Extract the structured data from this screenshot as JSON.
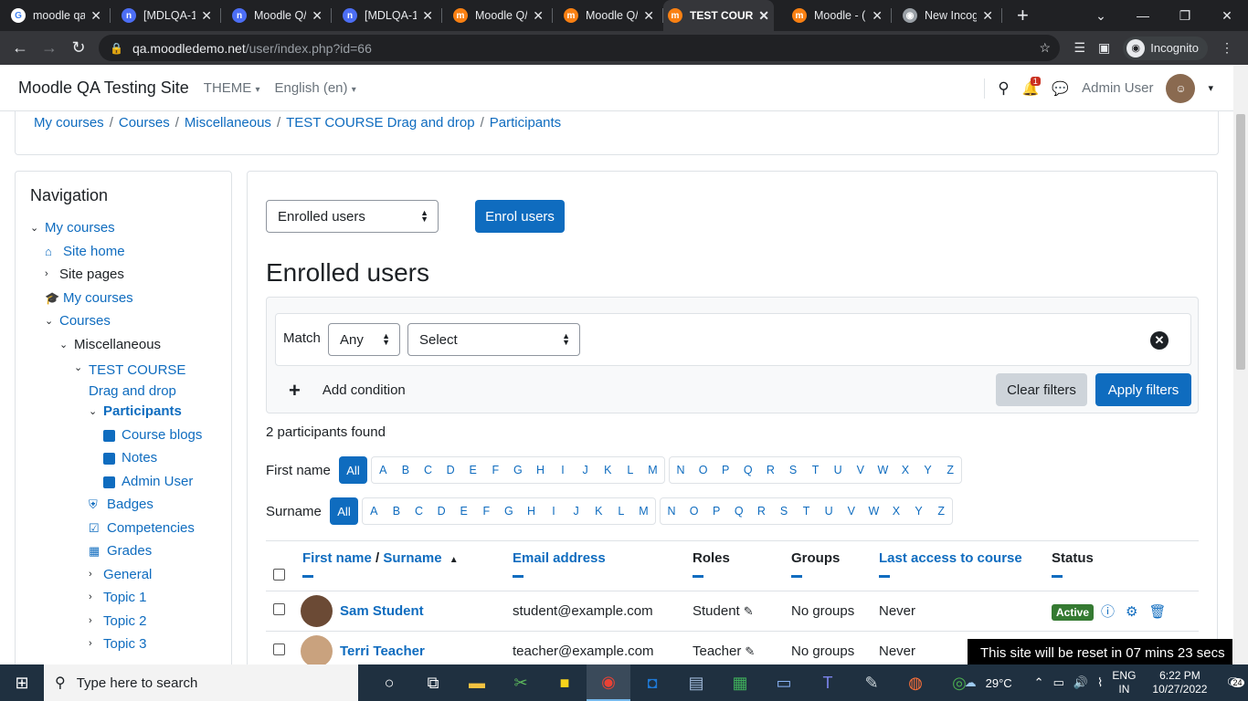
{
  "browser": {
    "tabs": [
      {
        "title": "moodle qa",
        "icon": "google-icon",
        "color": "#ffffff"
      },
      {
        "title": "[MDLQA-1",
        "icon": "jira-icon",
        "color": "#4c6ef5"
      },
      {
        "title": "Moodle Q/",
        "icon": "jira-icon",
        "color": "#4c6ef5"
      },
      {
        "title": "[MDLQA-1",
        "icon": "jira-icon",
        "color": "#4c6ef5"
      },
      {
        "title": "Moodle Q/",
        "icon": "moodle-icon",
        "color": "#f98012"
      },
      {
        "title": "Moodle Q/",
        "icon": "moodle-icon",
        "color": "#f98012"
      },
      {
        "title": "TEST COUR",
        "icon": "moodle-icon",
        "color": "#f98012",
        "active": true
      },
      {
        "title": "Moodle - (",
        "icon": "moodle-icon",
        "color": "#f98012"
      },
      {
        "title": "New Incog",
        "icon": "incognito-icon",
        "color": "#9aa0a6"
      }
    ],
    "url_host": "qa.moodledemo.net",
    "url_path": "/user/index.php?id=66",
    "incognito_label": "Incognito"
  },
  "header": {
    "site_name": "Moodle QA Testing Site",
    "theme_label": "THEME",
    "language_label": "English (en)",
    "notification_count": "1",
    "user_name": "Admin User"
  },
  "breadcrumb": [
    "My courses",
    "Courses",
    "Miscellaneous",
    "TEST COURSE Drag and drop",
    "Participants"
  ],
  "navigation": {
    "title": "Navigation",
    "items": [
      {
        "label": "My courses",
        "level": 0,
        "chev": "v",
        "link": true
      },
      {
        "label": "Site home",
        "level": 1,
        "icon": "home-icon",
        "link": true
      },
      {
        "label": "Site pages",
        "level": 1,
        "chev": ">",
        "link": false
      },
      {
        "label": "My courses",
        "level": 1,
        "icon": "graduation-cap-icon",
        "link": true
      },
      {
        "label": "Courses",
        "level": 1,
        "chev": "v",
        "link": true
      },
      {
        "label": "Miscellaneous",
        "level": 2,
        "chev": "v",
        "link": false
      },
      {
        "label": "TEST COURSE Drag",
        "label2": "and drop",
        "level": 3,
        "chev": "v",
        "link": true
      },
      {
        "label": "Participants",
        "level": 4,
        "chev": "v",
        "link": true,
        "bold": true
      },
      {
        "label": "Course blogs",
        "level": 5,
        "icon": "square-icon",
        "link": true
      },
      {
        "label": "Notes",
        "level": 5,
        "icon": "square-icon",
        "link": true
      },
      {
        "label": "Admin User",
        "level": 5,
        "icon": "square-icon",
        "link": true
      },
      {
        "label": "Badges",
        "level": 4,
        "icon": "shield-icon",
        "link": true
      },
      {
        "label": "Competencies",
        "level": 4,
        "icon": "check-square-icon",
        "link": true
      },
      {
        "label": "Grades",
        "level": 4,
        "icon": "table-icon",
        "link": true
      },
      {
        "label": "General",
        "level": 4,
        "chev": ">",
        "link": true
      },
      {
        "label": "Topic 1",
        "level": 4,
        "chev": ">",
        "link": true
      },
      {
        "label": "Topic 2",
        "level": 4,
        "chev": ">",
        "link": true
      },
      {
        "label": "Topic 3",
        "level": 4,
        "chev": ">",
        "link": true
      }
    ]
  },
  "main": {
    "view_select": "Enrolled users",
    "enrol_button": "Enrol users",
    "heading": "Enrolled users",
    "filter": {
      "match_label": "Match",
      "match_value": "Any",
      "type_value": "Select",
      "add_condition": "Add condition",
      "clear_filters": "Clear filters",
      "apply_filters": "Apply filters"
    },
    "participants_found": "2 participants found",
    "firstname_label": "First name",
    "surname_label": "Surname",
    "all_label": "All",
    "letters1": [
      "A",
      "B",
      "C",
      "D",
      "E",
      "F",
      "G",
      "H",
      "I",
      "J",
      "K",
      "L",
      "M"
    ],
    "letters2": [
      "N",
      "O",
      "P",
      "Q",
      "R",
      "S",
      "T",
      "U",
      "V",
      "W",
      "X",
      "Y",
      "Z"
    ],
    "columns": {
      "firstname": "First name",
      "separator": "/",
      "surname": "Surname",
      "email": "Email address",
      "roles": "Roles",
      "groups": "Groups",
      "last_access": "Last access to course",
      "status": "Status"
    },
    "rows": [
      {
        "name": "Sam Student",
        "email": "student@example.com",
        "role": "Student",
        "groups": "No groups",
        "last_access": "Never",
        "status": "Active"
      },
      {
        "name": "Terri Teacher",
        "email": "teacher@example.com",
        "role": "Teacher",
        "groups": "No groups",
        "last_access": "Never",
        "status": ""
      }
    ]
  },
  "toast": "This site will be reset in 07 mins 23 secs",
  "taskbar": {
    "search_placeholder": "Type here to search",
    "weather": "29°C",
    "lang1": "ENG",
    "lang2": "IN",
    "time": "6:22 PM",
    "date": "10/27/2022",
    "notif_count": "24"
  }
}
